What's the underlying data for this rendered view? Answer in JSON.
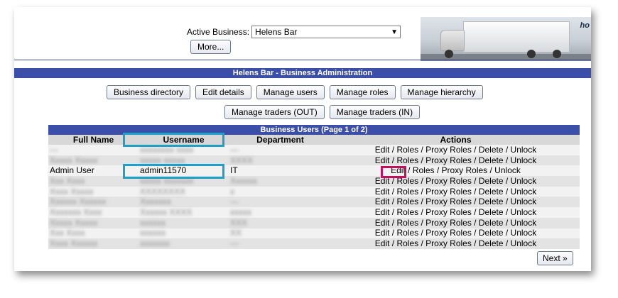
{
  "header": {
    "active_business_label": "Active Business:",
    "active_business_value": "Helens Bar",
    "more_label": "More...",
    "logo_text": "ho"
  },
  "title_bar": "Helens Bar - Business Administration",
  "buttons_row1": [
    "Business directory",
    "Edit details",
    "Manage users",
    "Manage roles",
    "Manage hierarchy"
  ],
  "buttons_row2": [
    "Manage traders (OUT)",
    "Manage traders (IN)"
  ],
  "table": {
    "caption": "Business Users (Page 1 of 2)",
    "columns": [
      "Full Name",
      "Username",
      "Department",
      "Actions"
    ],
    "actions_text": "Edit / Roles / Proxy Roles / Delete / Unlock",
    "actions_edit": "Edit",
    "actions_rest": " / Roles / Proxy Roles / Unlock",
    "rows": [
      {
        "full_name": "—",
        "username": "xxxxxxxx xxxx",
        "department": "—",
        "blurred": true
      },
      {
        "full_name": "Xxxxx Xxxxx",
        "username": "xxxxx xxxxx",
        "department": "XXXX",
        "blurred": true
      },
      {
        "full_name": "Admin User",
        "username": "admin11570",
        "department": "IT",
        "blurred": false
      },
      {
        "full_name": "Xxx Xxxx",
        "username": "xxxxx xxxxxxx",
        "department": "Xxxxxx",
        "blurred": true
      },
      {
        "full_name": "Xxxx Xxxxx",
        "username": "XXXXXXXX",
        "department": "x",
        "blurred": true
      },
      {
        "full_name": "Xxxxxx Xxxxxx",
        "username": "Xxxxxxx",
        "department": "—",
        "blurred": true
      },
      {
        "full_name": "Xxxxxxx Xxxx",
        "username": "Xxxxxx XXXX",
        "department": "xxxxx",
        "blurred": true
      },
      {
        "full_name": "Xxxxx Xxxxx",
        "username": "xxxxxx",
        "department": "XXX",
        "blurred": true
      },
      {
        "full_name": "Xxx Xxxx",
        "username": "xxxxxx",
        "department": "XX",
        "blurred": true
      },
      {
        "full_name": "Xxxx Xxxxxx",
        "username": "xxxxxxx",
        "department": "—",
        "blurred": true
      }
    ]
  },
  "next_label": "Next »",
  "colors": {
    "bar_blue": "#3c4fa8",
    "highlight_blue": "#1ea0c8",
    "highlight_red": "#c01060"
  }
}
